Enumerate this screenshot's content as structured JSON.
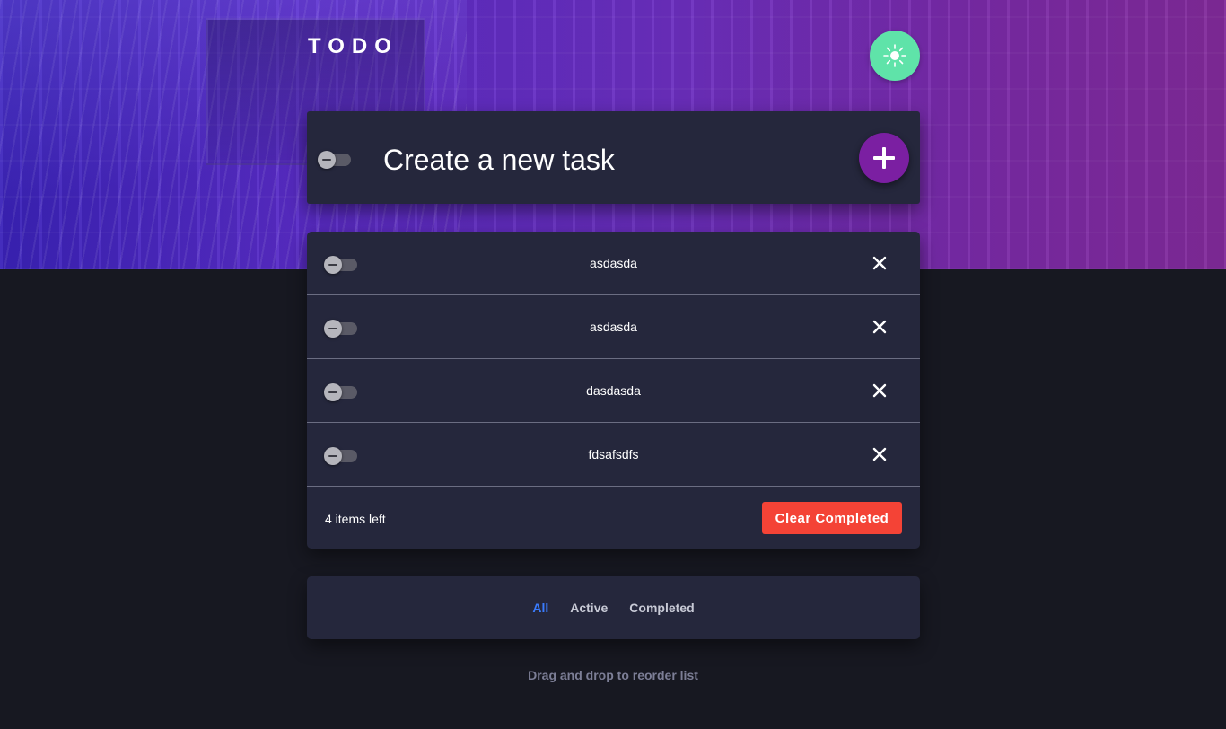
{
  "header": {
    "title": "TODO",
    "theme_toggle_icon": "sun-icon",
    "theme_toggle_color": "#5fe3a9"
  },
  "create": {
    "placeholder": "Create a new task",
    "add_icon": "plus-icon",
    "add_button_color": "#7b1fa2"
  },
  "tasks": [
    {
      "text": "asdasda",
      "completed": false
    },
    {
      "text": "asdasda",
      "completed": false
    },
    {
      "text": "dasdasda",
      "completed": false
    },
    {
      "text": "fdsafsdfs",
      "completed": false
    }
  ],
  "footer": {
    "items_left": "4 items left",
    "clear_label": "Clear Completed",
    "clear_color": "#f44336"
  },
  "filters": {
    "all": "All",
    "active": "Active",
    "completed": "Completed",
    "selected": "All",
    "selected_color": "#3a7bfd"
  },
  "hint": "Drag and drop to reorder list"
}
